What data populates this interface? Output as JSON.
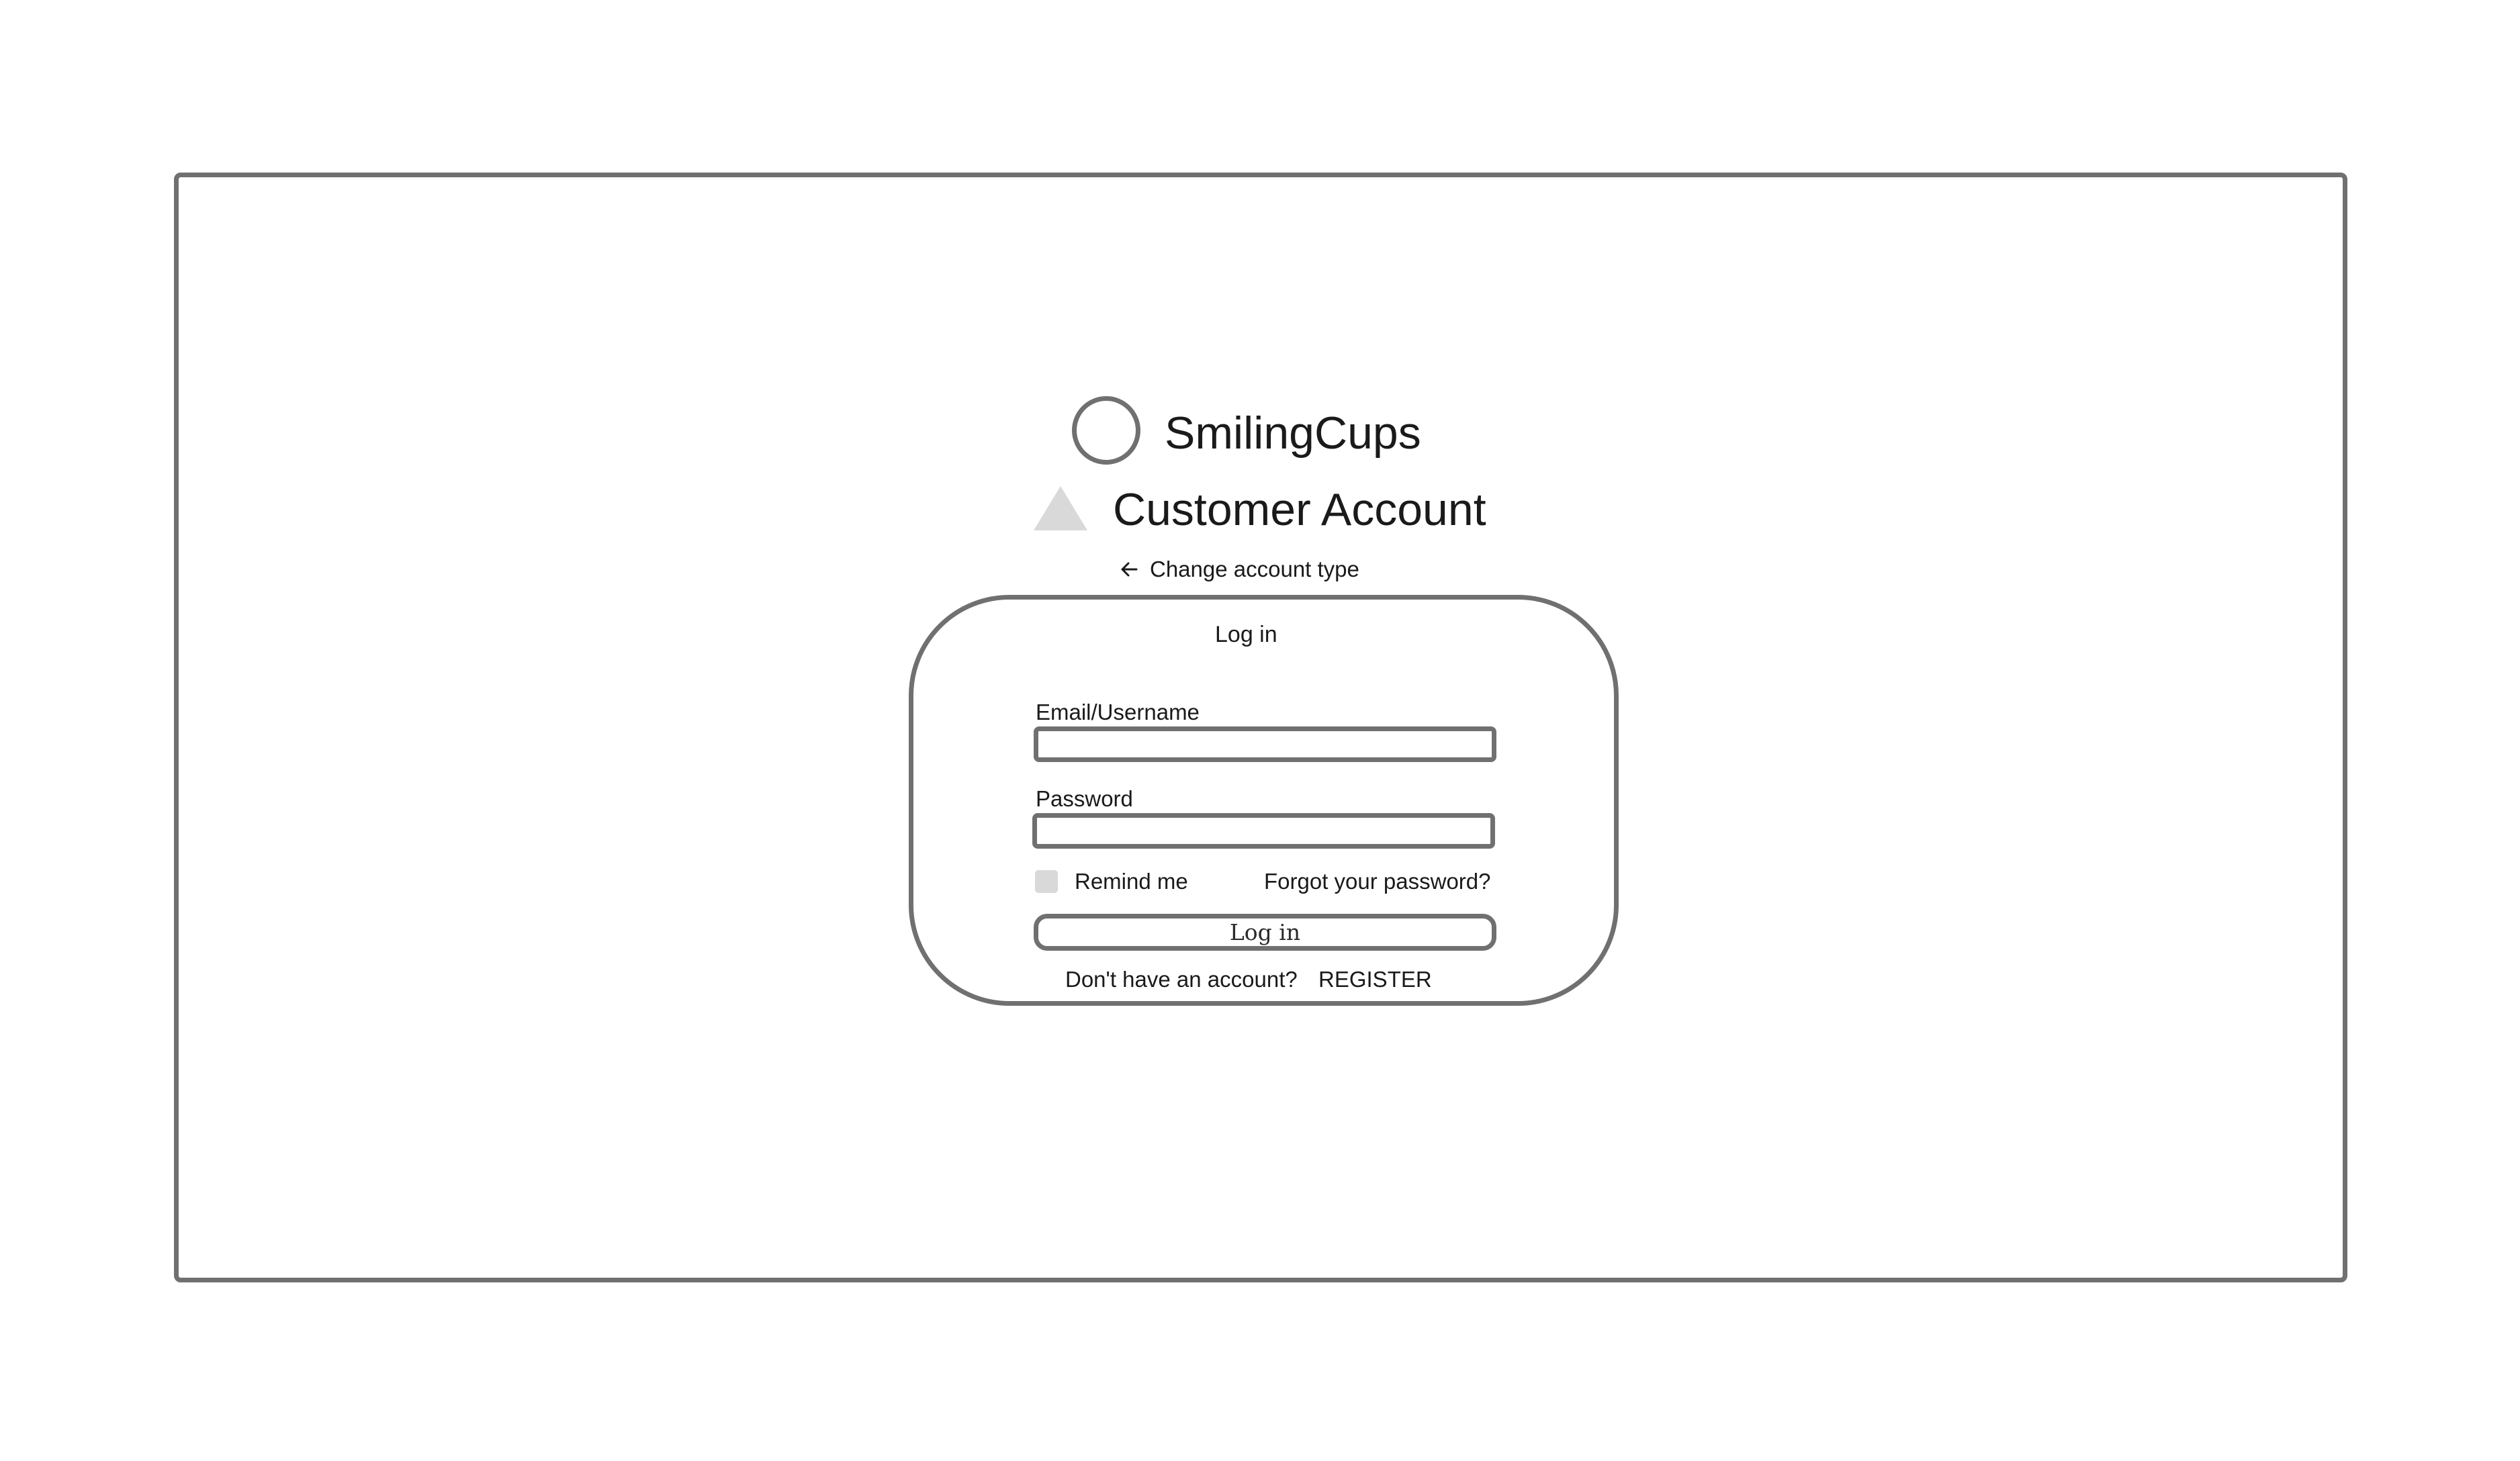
{
  "brand": {
    "name": "SmilingCups",
    "logo_icon": "circle-logo-icon"
  },
  "account": {
    "title": "Customer Account",
    "icon": "triangle-icon",
    "change_label": "Change account type",
    "change_icon": "arrow-left-icon"
  },
  "login_card": {
    "title": "Log in",
    "email": {
      "label": "Email/Username",
      "value": "",
      "placeholder": ""
    },
    "password": {
      "label": "Password",
      "value": "",
      "placeholder": ""
    },
    "remember": {
      "label": "Remind me",
      "checked": false
    },
    "forgot_label": "Forgot your password?",
    "submit_label": "Log in",
    "no_account_text": "Don't have an account?",
    "register_label": "REGISTER"
  },
  "colors": {
    "border": "#707070",
    "placeholder_fill": "#d9d9d9",
    "text": "#1a1a1a",
    "background": "#ffffff"
  }
}
